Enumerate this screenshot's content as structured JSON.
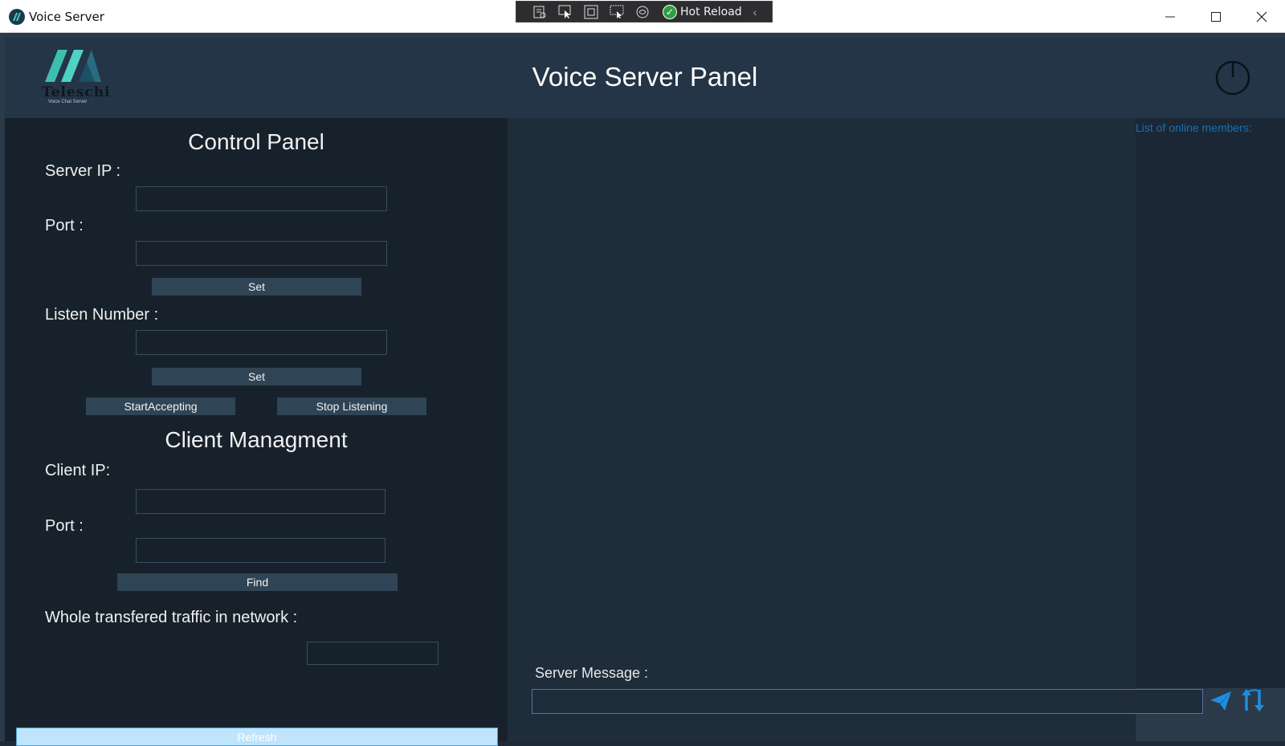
{
  "window": {
    "title": "Voice Server",
    "controls": [
      "minimize",
      "maximize",
      "close"
    ]
  },
  "devbar": {
    "tools": [
      "live-visual-tree-icon",
      "select-element-icon",
      "display-layout-adorners-icon",
      "track-focused-element-icon",
      "binding-failures-icon"
    ],
    "hot_reload_label": "Hot Reload",
    "collapse_glyph": "‹"
  },
  "header": {
    "logo_text": "Teleschi",
    "logo_subtitle": "Voice Chat Server",
    "title": "Voice Server Panel"
  },
  "control_panel": {
    "title": "Control Panel",
    "server_ip_label": "Server IP :",
    "server_ip_value": "",
    "port_label": "Port :",
    "port_value": "",
    "set_label": "Set",
    "listen_number_label": "Listen Number :",
    "listen_number_value": "",
    "set2_label": "Set",
    "start_accepting_label": "StartAccepting",
    "stop_listening_label": "Stop Listening"
  },
  "client_management": {
    "title": "Client Managment",
    "client_ip_label": "Client IP:",
    "client_ip_value": "",
    "port_label": "Port :",
    "port_value": "",
    "find_label": "Find",
    "traffic_label": "Whole transfered traffic in network :",
    "traffic_value": "",
    "refresh_label": "Refresh"
  },
  "members": {
    "title": "List of online members:",
    "items": []
  },
  "server_message": {
    "label": "Server Message :",
    "value": ""
  },
  "colors": {
    "header_bg": "#243547",
    "left_panel_bg": "#17212c",
    "button_bg": "#2f4556",
    "refresh_bg": "#bfe4fb",
    "accent_blue": "#1d8ee0"
  }
}
